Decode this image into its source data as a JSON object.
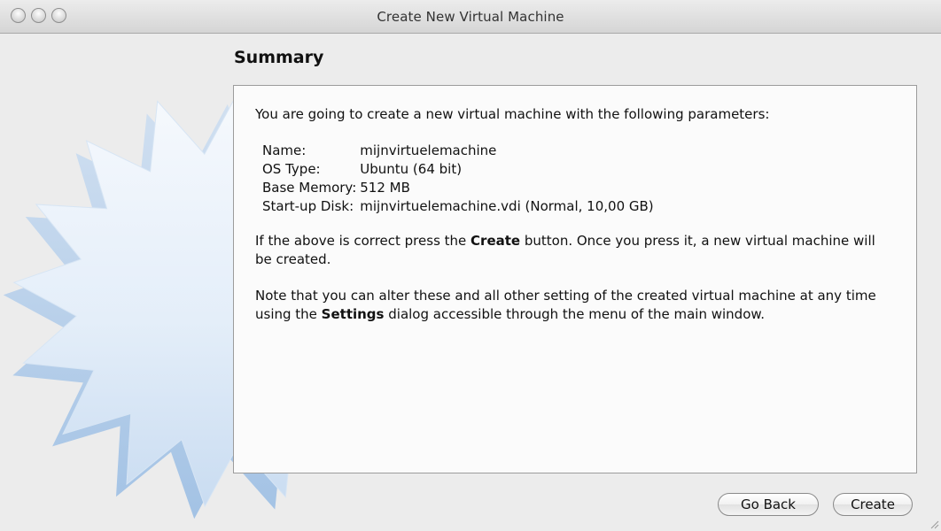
{
  "window": {
    "title": "Create New Virtual Machine"
  },
  "page": {
    "heading": "Summary"
  },
  "summary": {
    "intro": "You are going to create a new virtual machine with the following parameters:",
    "params": [
      {
        "key": "Name:",
        "value": "mijnvirtuelemachine"
      },
      {
        "key": "OS Type:",
        "value": "Ubuntu (64 bit)"
      },
      {
        "key": "Base Memory:",
        "value": "512 MB"
      },
      {
        "key": "Start-up Disk:",
        "value": "mijnvirtuelemachine.vdi (Normal, 10,00 GB)"
      }
    ],
    "confirm": {
      "before": "If the above is correct press the ",
      "bold": "Create",
      "after": " button. Once you press it, a new virtual machine will be created."
    },
    "note": {
      "before": "Note that you can alter these and all other setting of the created virtual machine at any time using the ",
      "bold": "Settings",
      "after": " dialog accessible through the menu of the main window."
    }
  },
  "buttons": {
    "back_label": "Go Back",
    "create_label": "Create"
  },
  "icons": {
    "close": "close-icon",
    "minimize": "minimize-icon",
    "zoom": "zoom-icon",
    "wizard_art": "starburst-watermark-icon"
  },
  "colors": {
    "window_bg": "#ececec",
    "content_bg": "#fbfbfb",
    "starburst": "#cfe0f3"
  }
}
